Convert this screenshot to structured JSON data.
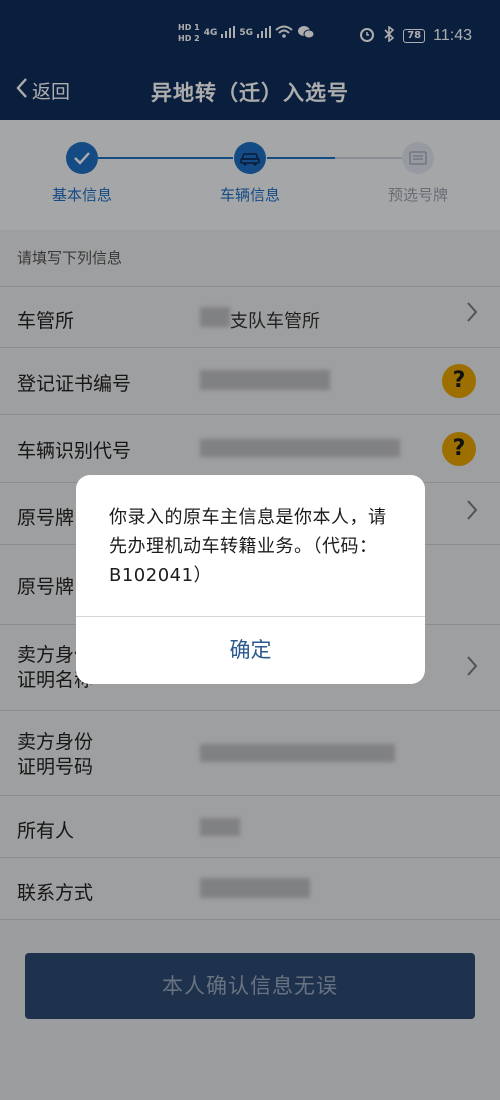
{
  "status_bar": {
    "hd1": "HD 1",
    "hd2": "HD 2",
    "net1": "4G",
    "net2": "5G",
    "battery": "78",
    "time": "11:43"
  },
  "nav": {
    "back_label": "返回",
    "title": "异地转（迁）入选号"
  },
  "steps": [
    {
      "label": "基本信息",
      "state": "done",
      "icon": "check-icon"
    },
    {
      "label": "车辆信息",
      "state": "current",
      "icon": "car-icon"
    },
    {
      "label": "预选号牌",
      "state": "pending",
      "icon": "plate-icon"
    }
  ],
  "form": {
    "hint": "请填写下列信息",
    "rows": [
      {
        "label": "车管所",
        "value": "支队车管所"
      },
      {
        "label": "登记证书编号"
      },
      {
        "label": "车辆识别代号"
      },
      {
        "label": "原号牌"
      },
      {
        "label": "原号牌"
      },
      {
        "label": "卖方身份证明名称"
      },
      {
        "label": "卖方身份证明号码"
      },
      {
        "label": "所有人"
      },
      {
        "label": "联系方式"
      }
    ]
  },
  "confirm_button": "本人确认信息无误",
  "dialog": {
    "message": "你录入的原车主信息是你本人，请先办理机动车转籍业务。（代码：B102041）",
    "ok_label": "确定"
  },
  "colors": {
    "header_bg": "#102f5c",
    "step_active": "#1f6fc4",
    "question_badge": "#e6a400",
    "dialog_ok": "#2a5a8e"
  }
}
